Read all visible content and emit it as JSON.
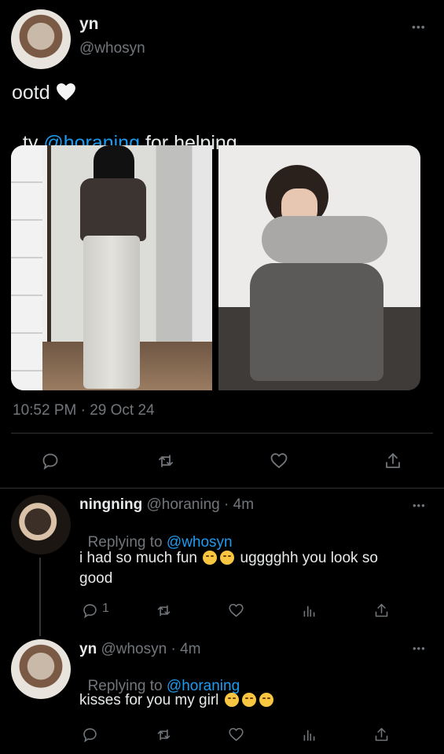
{
  "main_tweet": {
    "display_name": "yn",
    "handle": "@whosyn",
    "line1_text": "ootd",
    "line1_emoji": "white-heart",
    "line2_prefix": "ty ",
    "line2_mention": "@horaning",
    "line2_suffix": " for helping",
    "timestamp": "10:52 PM · 29 Oct 24",
    "more_label": "•••"
  },
  "actions": [
    "reply-icon",
    "retweet-icon",
    "like-icon",
    "share-icon"
  ],
  "replies": [
    {
      "display_name": "ningning",
      "handle": "@horaning",
      "time": "· 4m",
      "replying_label": "Replying to ",
      "replying_to": "@whosyn",
      "text_part1": "i had so much fun",
      "text_part2": "ugggghh you look so",
      "text_part3": "good",
      "reply_count": "1",
      "more_label": "•••"
    },
    {
      "display_name": "yn",
      "handle": "@whosyn",
      "time": "· 4m",
      "replying_label": "Replying to ",
      "replying_to": "@horaning",
      "text": "kisses for you my girl",
      "more_label": "•••"
    }
  ],
  "colors": {
    "background": "#000000",
    "text": "#e7e9ea",
    "muted": "#71767b",
    "link": "#1d9bf0",
    "divider": "#2f3336"
  }
}
